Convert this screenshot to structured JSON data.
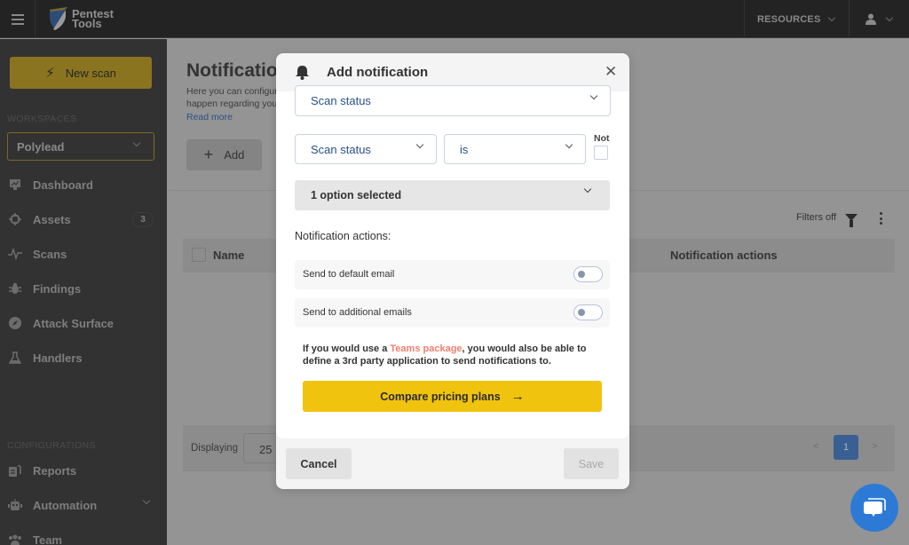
{
  "topbar": {
    "logo_line1": "Pentest",
    "logo_line2": "Tools",
    "resources_label": "RESOURCES"
  },
  "sidebar": {
    "new_scan_label": "New scan",
    "workspaces_label": "WORKSPACES",
    "workspace_selected": "Polylead",
    "items": [
      {
        "label": "Dashboard",
        "icon": "chart-icon"
      },
      {
        "label": "Assets",
        "icon": "crosshair-icon",
        "badge": "3"
      },
      {
        "label": "Scans",
        "icon": "pulse-icon"
      },
      {
        "label": "Findings",
        "icon": "bug-icon"
      },
      {
        "label": "Attack Surface",
        "icon": "compass-icon"
      },
      {
        "label": "Handlers",
        "icon": "flask-icon"
      }
    ],
    "configurations_label": "CONFIGURATIONS",
    "config_items": [
      {
        "label": "Reports",
        "icon": "reports-icon"
      },
      {
        "label": "Automation",
        "icon": "robot-icon"
      },
      {
        "label": "Team",
        "icon": "team-icon"
      }
    ]
  },
  "page": {
    "title": "Notifications",
    "description_line1": "Here you can configure",
    "description_line2": "happen regarding your",
    "read_more": "Read more",
    "add_label": "Add",
    "filters_label": "Filters off",
    "table": {
      "columns": [
        "Name",
        "Notification actions"
      ]
    },
    "footer": {
      "displaying_label": "Displaying",
      "per_page": "25",
      "current_page": "1",
      "prev": "<",
      "next": ">"
    }
  },
  "modal": {
    "title": "Add notification",
    "trigger_select": "Scan status",
    "condition_field": "Scan status",
    "condition_operator": "is",
    "not_label": "Not",
    "not_checked": false,
    "value_select": "1 option selected",
    "actions_label": "Notification actions:",
    "toggles": [
      {
        "label": "Send to default email",
        "on": false
      },
      {
        "label": "Send to additional emails",
        "on": false
      }
    ],
    "upsell_prefix": "If you would use a ",
    "upsell_link": "Teams package",
    "upsell_suffix": ", you would also be able to define a 3rd party application to send notifications to.",
    "pricing_button": "Compare pricing plans",
    "pricing_arrow": "→",
    "cancel_label": "Cancel",
    "save_label": "Save",
    "close_glyph": "✕"
  },
  "colors": {
    "accent_yellow": "#f0c30f",
    "link_blue": "#2a4f86",
    "upsell_link": "#f27f6e",
    "chat_blue": "#2d7ad6"
  }
}
